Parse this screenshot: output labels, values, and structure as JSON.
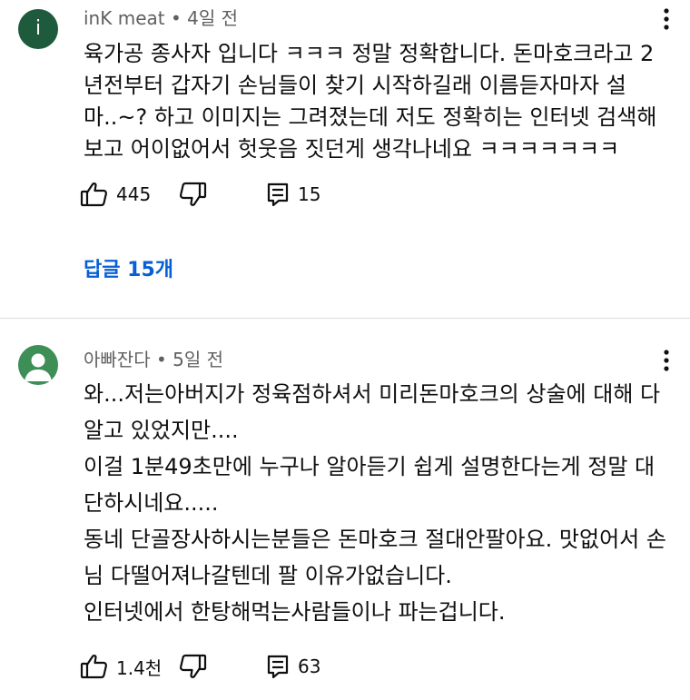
{
  "comments": [
    {
      "avatar_letter": "i",
      "avatar_color": "#1e5a3c",
      "author": "inK meat",
      "age": "4일 전",
      "lines": [
        "육가공 종사자 입니다 ㅋㅋㅋ 정말 정확합니다. 돈마호크라고 2",
        "년전부터 갑자기 손님들이 찾기 시작하길래 이름듣자마자 설",
        "마..~? 하고 이미지는 그려졌는데 저도 정확히는 인터넷 검색해",
        "보고 어이없어서 헛웃음 짓던게 생각나네요 ㅋㅋㅋㅋㅋㅋㅋ"
      ],
      "likes": "445",
      "reply_count": "15",
      "replies_label": "답글 15개"
    },
    {
      "avatar_color": "#3e8e57",
      "author": "아빠잔다",
      "age": "5일 전",
      "lines": [
        "와...저는아버지가 정육점하셔서 미리돈마호크의 상술에 대해 다",
        "알고 있었지만....",
        "이걸 1분49초만에 누구나 알아듣기 쉽게 설명한다는게 정말 대",
        "단하시네요.....",
        "동네 단골장사하시는분들은 돈마호크 절대안팔아요. 맛없어서 손",
        "님 다떨어져나갈텐데 팔 이유가없습니다.",
        "인터넷에서 한탕해먹는사람들이나 파는겁니다."
      ],
      "likes": "1.4천",
      "reply_count": "63"
    }
  ],
  "icons": {
    "like": "thumb-up-icon",
    "dislike": "thumb-down-icon",
    "reply": "reply-icon",
    "menu": "more-vert-icon",
    "default_avatar": "person-icon"
  }
}
